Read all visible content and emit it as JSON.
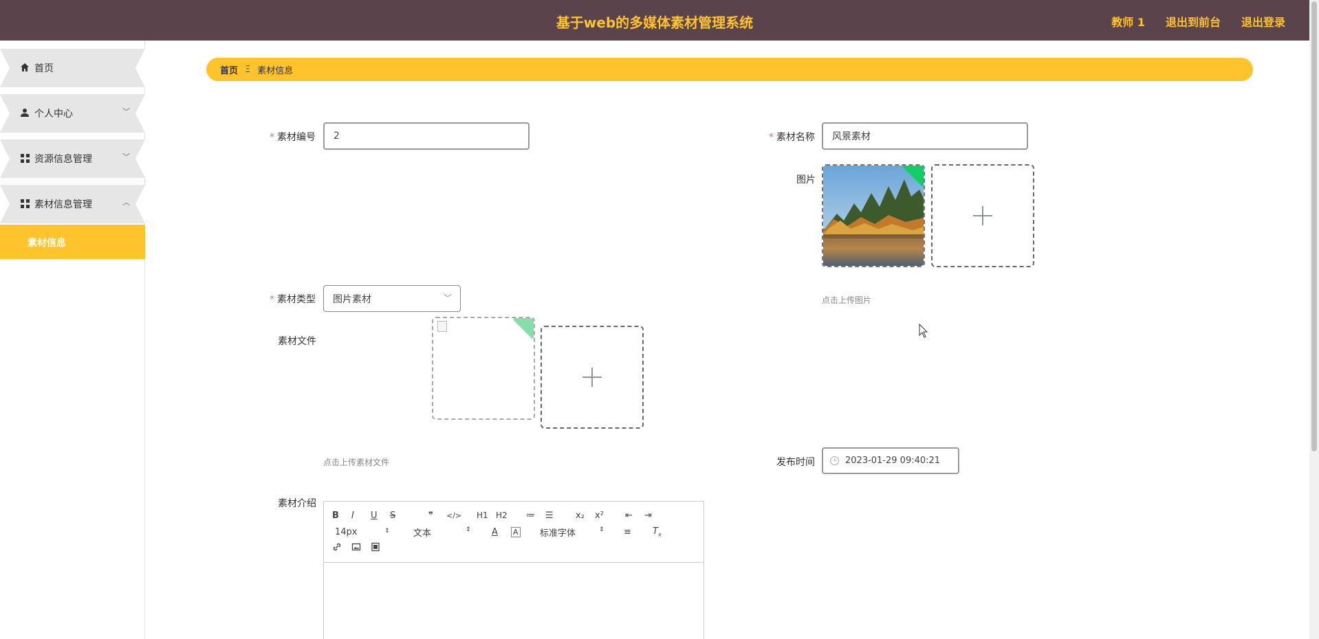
{
  "header": {
    "title": "基于web的多媒体素材管理系统",
    "user": "教师 1",
    "to_front": "退出到前台",
    "logout": "退出登录"
  },
  "sidebar": {
    "items": [
      {
        "label": "首页",
        "icon": "home-icon"
      },
      {
        "label": "个人中心",
        "icon": "user-icon",
        "arrow": "﹀"
      },
      {
        "label": "资源信息管理",
        "icon": "grid-icon",
        "arrow": "﹀"
      },
      {
        "label": "素材信息管理",
        "icon": "grid-icon",
        "arrow": "︿"
      }
    ],
    "subitem": "素材信息"
  },
  "breadcrumb": {
    "home": "首页",
    "separator": "Ξ",
    "current": "素材信息"
  },
  "form": {
    "material_no": {
      "label": "素材编号",
      "value": "2"
    },
    "material_name": {
      "label": "素材名称",
      "value": "风景素材"
    },
    "image": {
      "label": "图片",
      "hint": "点击上传图片"
    },
    "material_type": {
      "label": "素材类型",
      "value": "图片素材"
    },
    "material_file": {
      "label": "素材文件",
      "hint": "点击上传素材文件"
    },
    "publish_time": {
      "label": "发布时间",
      "value": "2023-01-29 09:40:21"
    },
    "intro": {
      "label": "素材介绍"
    }
  },
  "editor": {
    "row1": [
      "B",
      "I",
      "U",
      "S",
      "❞",
      "</>",
      "H1",
      "H2",
      "≔",
      "☰",
      "x₂",
      "x²",
      "⇤",
      "⇥"
    ],
    "font_size": "14px",
    "header_type": "文本",
    "font_family": "标准字体"
  },
  "colors": {
    "header_bg": "#5b434c",
    "accent": "#ffc32b",
    "required": "#f56c6c",
    "success": "#13ce66"
  }
}
